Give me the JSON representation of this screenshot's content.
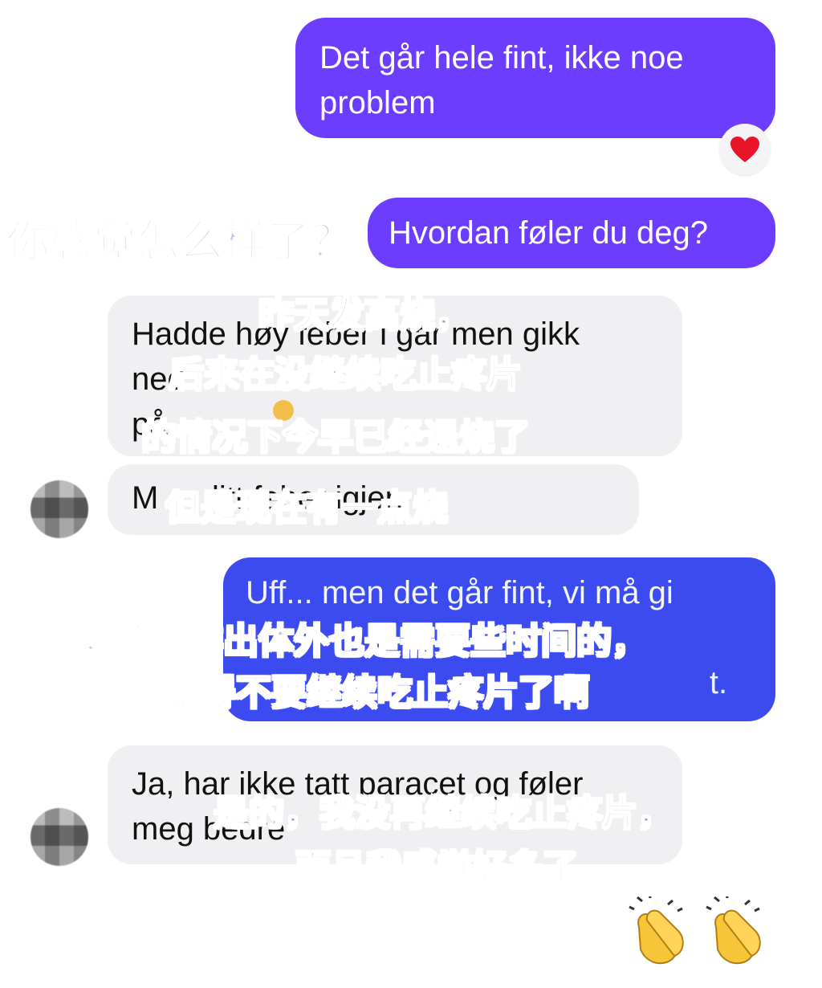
{
  "messages": [
    {
      "sender": "me",
      "style": "purple",
      "text": "Det går hele fint, ikke noe\nproblem",
      "reaction": "heart"
    },
    {
      "sender": "me",
      "style": "purple",
      "text": "Hvordan føler du deg?"
    },
    {
      "sender": "other",
      "style": "gray",
      "text": "Hadde høy feber i går men gikk\nned\npå"
    },
    {
      "sender": "other",
      "style": "gray",
      "text": "M      litt feber igjen"
    },
    {
      "sender": "me",
      "style": "blue",
      "text": "Uff... men det går fint, vi må gi\n\n                                                    t."
    },
    {
      "sender": "other",
      "style": "gray",
      "text": "Ja, har ikke tatt paracet og føler\nmeg bedre"
    }
  ],
  "overlays": {
    "how_feel": "你感觉怎么样了？",
    "fever_1": "昨天发高烧，",
    "fever_2": "后来在没继续吃止疼片",
    "fever_3": "的情况下今早已经退烧了",
    "now": "但是现在有一点烧",
    "reply_1": "唉，病毒排出体外也是需要些时间的，",
    "reply_2": "记得不要继续吃止疼片了啊",
    "better_1": "是的，我没再继续吃止疼片，",
    "better_2": "而且我感觉好多了。"
  },
  "colors": {
    "purple": "#6d3dff",
    "blue": "#3c4bf0",
    "gray": "#f0f0f3",
    "heart": "#e8152a"
  }
}
